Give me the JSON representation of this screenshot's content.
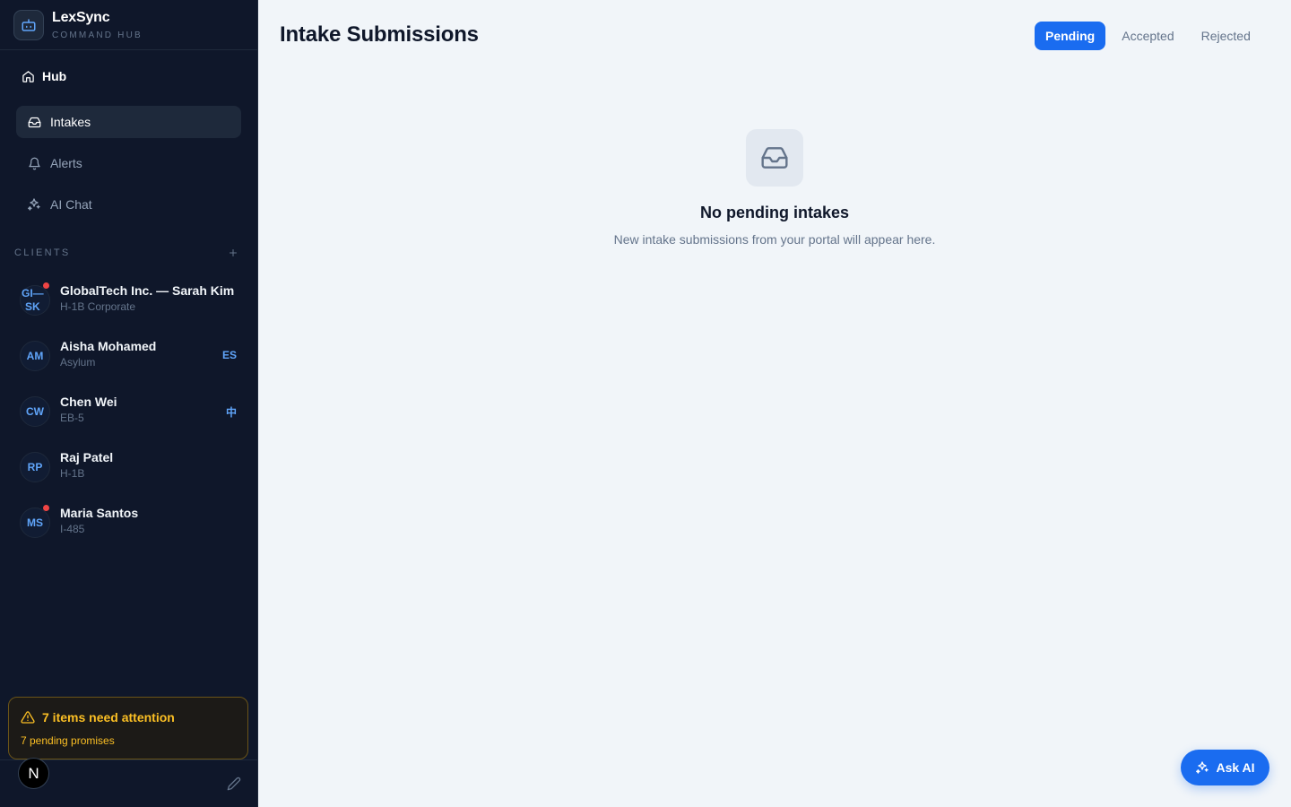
{
  "brand": {
    "name": "LexSync",
    "subtitle": "COMMAND HUB"
  },
  "nav": {
    "hub": "Hub",
    "items": [
      {
        "label": "Intakes",
        "icon": "inbox-icon",
        "active": true
      },
      {
        "label": "Alerts",
        "icon": "bell-icon",
        "active": false
      },
      {
        "label": "AI Chat",
        "icon": "sparkles-icon",
        "active": false
      }
    ]
  },
  "clients": {
    "header": "CLIENTS",
    "list": [
      {
        "initials_top": "GI—",
        "initials_bottom": "SK",
        "name": "GlobalTech Inc. — Sarah Kim",
        "case_type": "H-1B Corporate",
        "unread": true,
        "lang": ""
      },
      {
        "initials": "AM",
        "name": "Aisha Mohamed",
        "case_type": "Asylum",
        "unread": false,
        "lang": "ES"
      },
      {
        "initials": "CW",
        "name": "Chen Wei",
        "case_type": "EB-5",
        "unread": false,
        "lang": "中"
      },
      {
        "initials": "RP",
        "name": "Raj Patel",
        "case_type": "H-1B",
        "unread": false,
        "lang": ""
      },
      {
        "initials": "MS",
        "name": "Maria Santos",
        "case_type": "I-485",
        "unread": true,
        "lang": ""
      }
    ]
  },
  "attention": {
    "title": "7 items need attention",
    "subtitle": "7 pending promises"
  },
  "user": {
    "avatar": "N"
  },
  "main": {
    "title": "Intake Submissions",
    "tabs": [
      {
        "label": "Pending",
        "active": true
      },
      {
        "label": "Accepted",
        "active": false
      },
      {
        "label": "Rejected",
        "active": false
      }
    ],
    "empty": {
      "icon": "inbox-icon",
      "title": "No pending intakes",
      "subtitle": "New intake submissions from your portal will appear here."
    }
  },
  "ask_ai": {
    "label": "Ask AI",
    "icon": "sparkles-icon"
  },
  "colors": {
    "accent": "#1a6cf0",
    "sidebar": "#0f172a",
    "warning": "#fbbf24",
    "alert_dot": "#ef4444"
  }
}
